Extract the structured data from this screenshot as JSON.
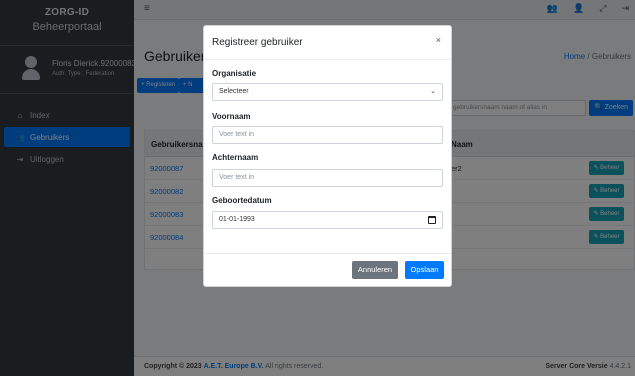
{
  "sidebar": {
    "brand_title": "ZORG-ID",
    "brand_subtitle": "Beheerportaal",
    "user_name": "Floris Dierick.92000083",
    "user_type": "Auth. Type : Federation",
    "items": [
      {
        "icon": "home-icon",
        "glyph": "⌂",
        "label": "Index"
      },
      {
        "icon": "users-icon",
        "glyph": "👥",
        "label": "Gebruikers"
      },
      {
        "icon": "sign-out-icon",
        "glyph": "⇥",
        "label": "Uitloggen"
      }
    ]
  },
  "topbar": {
    "menu_glyph": "≡",
    "icons": [
      {
        "icon": "users-icon",
        "glyph": "👥"
      },
      {
        "icon": "user-icon",
        "glyph": "👤"
      },
      {
        "icon": "expand-icon",
        "glyph": "⤢"
      },
      {
        "icon": "logout-icon",
        "glyph": "⇥"
      }
    ]
  },
  "main": {
    "page_title": "Gebruikers",
    "breadcrumb_home": "Home",
    "breadcrumb_sep": "/",
    "breadcrumb_current": "Gebruikers",
    "register_button": "+ Registeren",
    "register_button2": "+ N",
    "search_placeholder": "gebruikersnaam naam of alias in",
    "search_button": "🔍 Zoeken",
    "table": {
      "col1": "Gebruikersnaam",
      "col2": "Naam",
      "rows": [
        {
          "username": "92000087",
          "name": "er2",
          "action": "Beheer"
        },
        {
          "username": "92000082",
          "name": "",
          "action": "Beheer"
        },
        {
          "username": "92000083",
          "name": "",
          "action": "Beheer"
        },
        {
          "username": "92000084",
          "name": "",
          "action": "Beheer"
        }
      ]
    }
  },
  "footer": {
    "copyright": "Copyright © 2023",
    "company": "A.E.T. Europe B.V.",
    "rights": "All rights reserved.",
    "version_label": "Server Core Versie",
    "version": "4.4.2.1"
  },
  "modal": {
    "title": "Registreer gebruiker",
    "close_glyph": "×",
    "org_label": "Organisatie",
    "org_value": "Selecteer",
    "first_name_label": "Voornaam",
    "first_name_placeholder": "Voer text in",
    "last_name_label": "Achternaam",
    "last_name_placeholder": "Voer text in",
    "birthdate_label": "Geboortedatum",
    "birthdate_value": "01-01-1993",
    "cancel_label": "Annuleren",
    "save_label": "Opslaan"
  }
}
